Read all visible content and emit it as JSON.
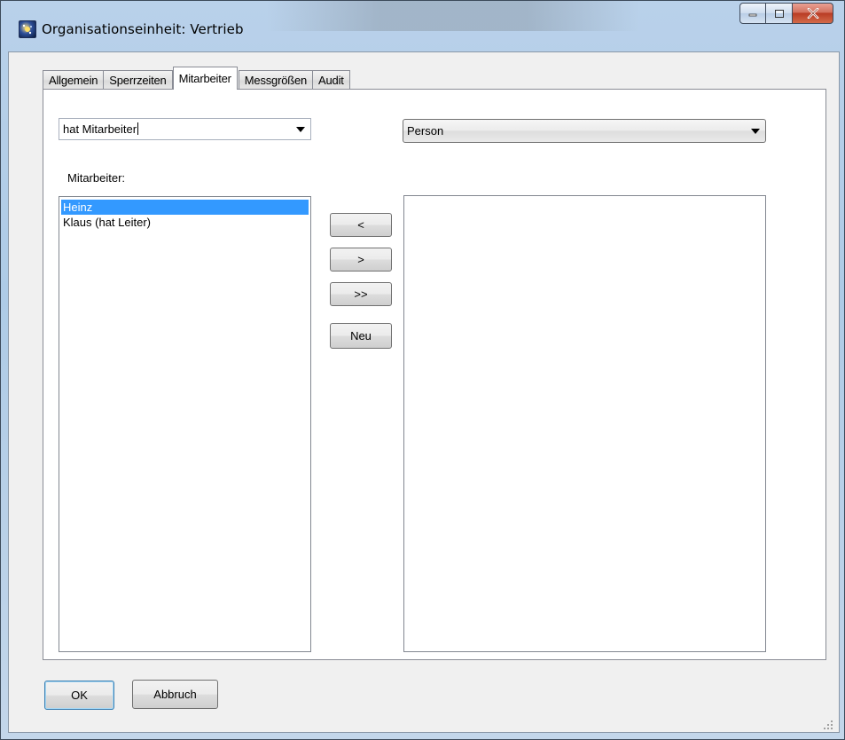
{
  "window": {
    "title": "Organisationseinheit: Vertrieb"
  },
  "tabs": [
    {
      "label": "Allgemein",
      "active": false
    },
    {
      "label": "Sperrzeiten",
      "active": false
    },
    {
      "label": "Mitarbeiter",
      "active": true
    },
    {
      "label": "Messgrößen",
      "active": false
    },
    {
      "label": "Audit",
      "active": false
    }
  ],
  "relation_combo": {
    "value": "hat Mitarbeiter"
  },
  "type_combo": {
    "value": "Person"
  },
  "members_label": "Mitarbeiter:",
  "members_list": [
    {
      "label": "Heinz",
      "selected": true
    },
    {
      "label": "Klaus (hat Leiter)",
      "selected": false
    }
  ],
  "transfer_buttons": {
    "add": "<",
    "remove": ">",
    "remove_all": ">>",
    "new": "Neu"
  },
  "footer": {
    "ok": "OK",
    "cancel": "Abbruch"
  },
  "colors": {
    "selection": "#3399ff",
    "close_button": "#c7432b",
    "frame": "#b9d1ea"
  }
}
